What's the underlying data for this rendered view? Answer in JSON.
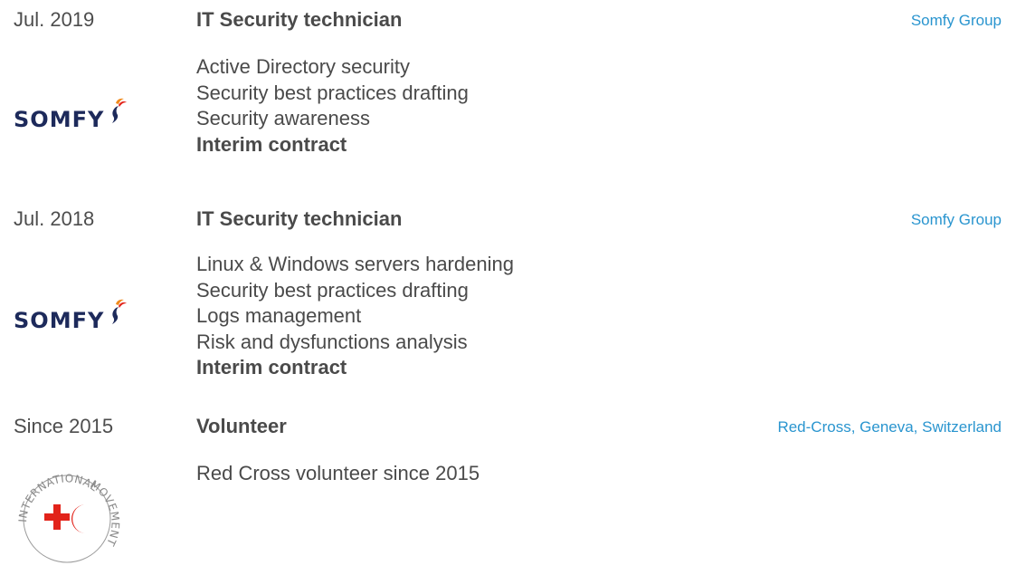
{
  "entries": [
    {
      "date": "Jul. 2019",
      "title": "IT Security technician",
      "company": "Somfy Group",
      "logo": "somfy-logo",
      "logo_text": "SOMFY",
      "items": [
        {
          "text": "Active Directory security",
          "bold": false
        },
        {
          "text": "Security best practices drafting",
          "bold": false
        },
        {
          "text": "Security awareness",
          "bold": false
        },
        {
          "text": "Interim contract",
          "bold": true
        }
      ]
    },
    {
      "date": "Jul. 2018",
      "title": "IT Security technician",
      "company": "Somfy Group",
      "logo": "somfy-logo",
      "logo_text": "SOMFY",
      "items": [
        {
          "text": "Linux & Windows servers hardening",
          "bold": false
        },
        {
          "text": "Security best practices drafting",
          "bold": false
        },
        {
          "text": "Logs management",
          "bold": false
        },
        {
          "text": "Risk and dysfunctions analysis",
          "bold": false
        },
        {
          "text": "Interim contract",
          "bold": true
        }
      ]
    },
    {
      "date": "Since 2015",
      "title": "Volunteer",
      "company": "Red-Cross, Geneva, Switzerland",
      "logo": "red-cross-red-crescent-logo",
      "logo_text": "INTERNATIONAL MOVEMENT",
      "items": [
        {
          "text": "Red Cross volunteer since 2015",
          "bold": false
        }
      ]
    }
  ],
  "colors": {
    "link": "#2a95cf",
    "text": "#4a4a4a",
    "somfy_navy": "#1d2a5b",
    "somfy_orange": "#f08a1d",
    "somfy_red": "#e2231a",
    "red_cross": "#e2231a"
  }
}
